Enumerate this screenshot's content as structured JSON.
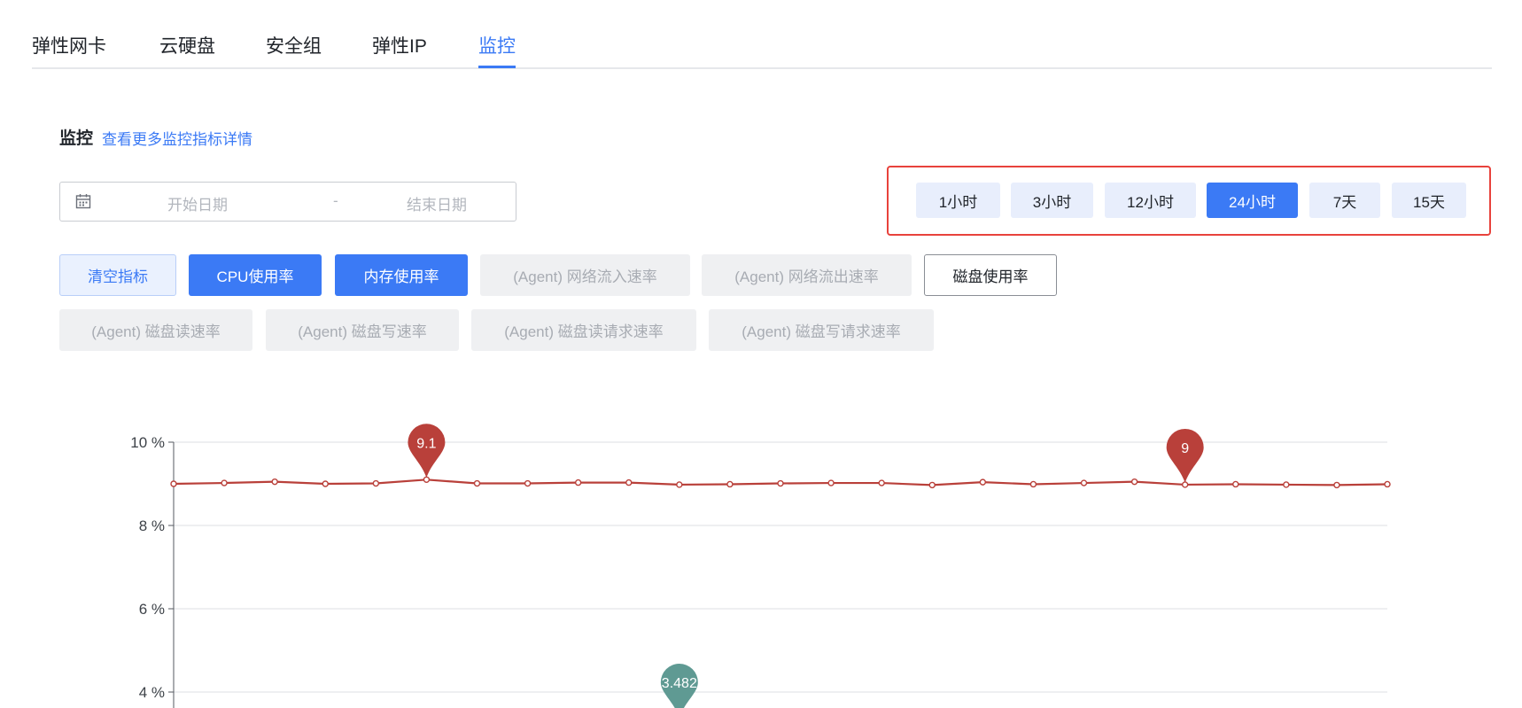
{
  "tabs": [
    {
      "label": "弹性网卡",
      "active": false
    },
    {
      "label": "云硬盘",
      "active": false
    },
    {
      "label": "安全组",
      "active": false
    },
    {
      "label": "弹性IP",
      "active": false
    },
    {
      "label": "监控",
      "active": true
    }
  ],
  "monitor": {
    "title": "监控",
    "detail_link": "查看更多监控指标详情"
  },
  "date_range": {
    "start_placeholder": "开始日期",
    "separator": "-",
    "end_placeholder": "结束日期",
    "icon": "calendar-icon"
  },
  "time_ranges": [
    {
      "label": "1小时",
      "active": false
    },
    {
      "label": "3小时",
      "active": false
    },
    {
      "label": "12小时",
      "active": false
    },
    {
      "label": "24小时",
      "active": true
    },
    {
      "label": "7天",
      "active": false
    },
    {
      "label": "15天",
      "active": false
    }
  ],
  "metrics": {
    "clear_label": "清空指标",
    "row1": [
      {
        "label": "CPU使用率",
        "state": "selected"
      },
      {
        "label": "内存使用率",
        "state": "selected"
      },
      {
        "label": "(Agent) 网络流入速率",
        "state": "disabled"
      },
      {
        "label": "(Agent) 网络流出速率",
        "state": "disabled"
      },
      {
        "label": "磁盘使用率",
        "state": "available"
      }
    ],
    "row2": [
      {
        "label": "(Agent) 磁盘读速率",
        "state": "disabled"
      },
      {
        "label": "(Agent) 磁盘写速率",
        "state": "disabled"
      },
      {
        "label": "(Agent) 磁盘读请求速率",
        "state": "disabled"
      },
      {
        "label": "(Agent) 磁盘写请求速率",
        "state": "disabled"
      }
    ]
  },
  "colors": {
    "accent": "#3b7af5",
    "highlight_border": "#e8423c",
    "series_memory": "#b9403a",
    "series_cpu": "#5f9a93"
  },
  "chart_data": {
    "type": "line",
    "y_ticks": [
      "10 %",
      "8 %",
      "6 %",
      "4 %"
    ],
    "ylim": [
      4,
      10
    ],
    "grid": true,
    "series": [
      {
        "values": [
          9.0,
          9.02,
          9.05,
          9.0,
          9.01,
          9.1,
          9.01,
          9.01,
          9.03,
          9.03,
          8.98,
          8.99,
          9.01,
          9.02,
          9.02,
          8.97,
          9.04,
          8.99,
          9.02,
          9.05,
          8.98,
          8.99,
          8.98,
          8.97,
          8.99
        ],
        "max_marker": {
          "index": 5,
          "label": "9.1"
        },
        "min_marker": {
          "index": 20,
          "label": "9"
        }
      },
      {
        "min_marker": {
          "index": 10,
          "label": "3.482"
        }
      }
    ]
  }
}
